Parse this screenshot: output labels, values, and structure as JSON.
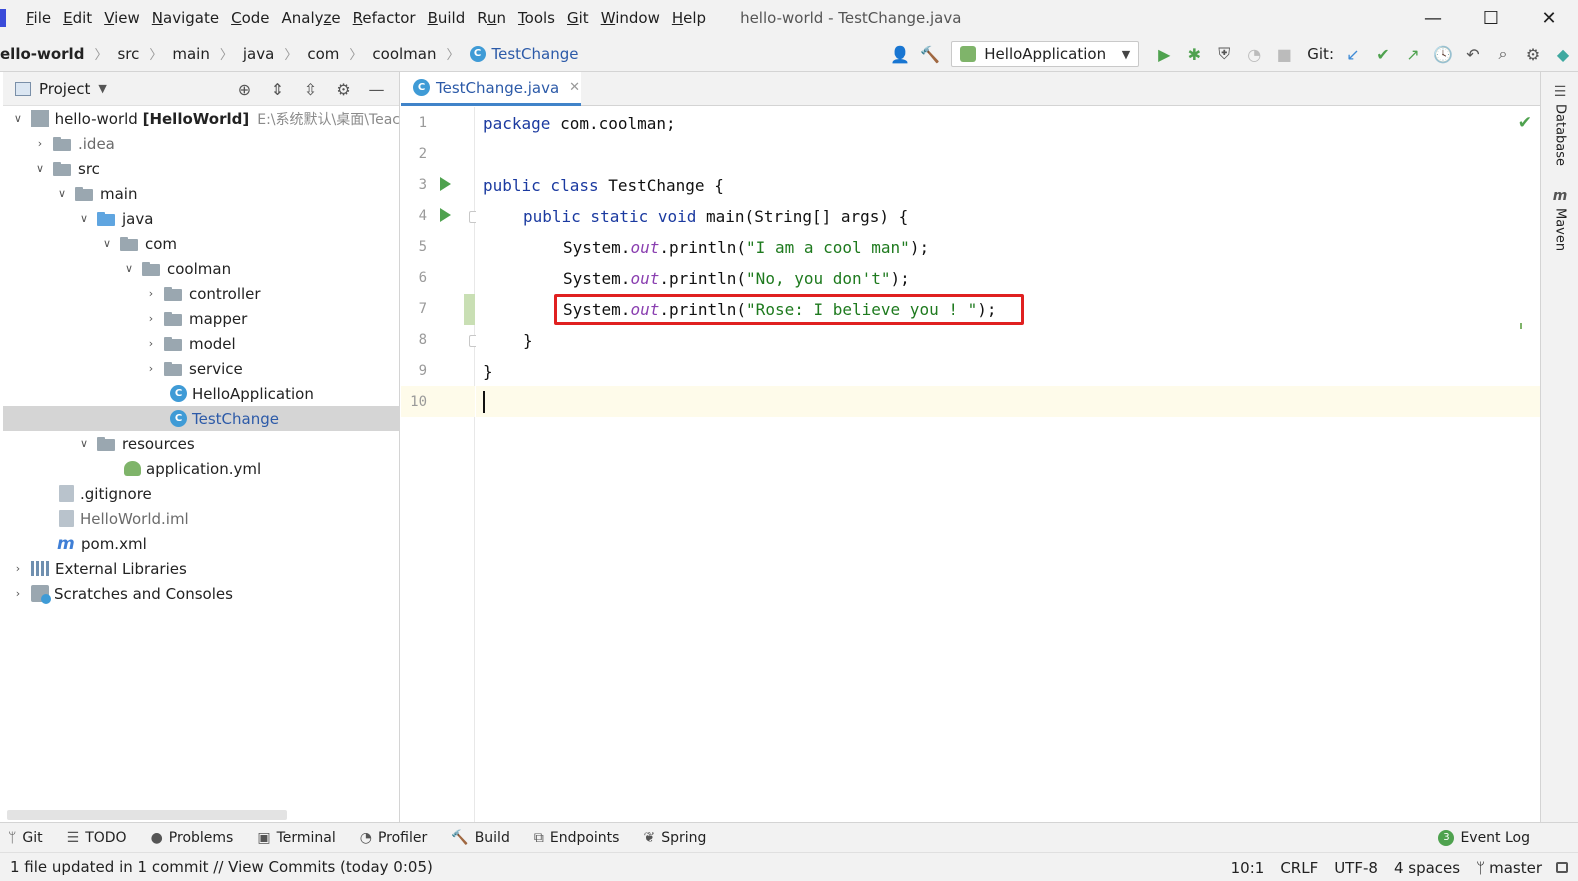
{
  "menu": {
    "items": [
      {
        "pre": "",
        "mn": "F",
        "post": "ile"
      },
      {
        "pre": "",
        "mn": "E",
        "post": "dit"
      },
      {
        "pre": "",
        "mn": "V",
        "post": "iew"
      },
      {
        "pre": "",
        "mn": "N",
        "post": "avigate"
      },
      {
        "pre": "",
        "mn": "C",
        "post": "ode"
      },
      {
        "pre": "Analy",
        "mn": "z",
        "post": "e"
      },
      {
        "pre": "",
        "mn": "R",
        "post": "efactor"
      },
      {
        "pre": "",
        "mn": "B",
        "post": "uild"
      },
      {
        "pre": "R",
        "mn": "u",
        "post": "n"
      },
      {
        "pre": "",
        "mn": "T",
        "post": "ools"
      },
      {
        "pre": "",
        "mn": "G",
        "post": "it"
      },
      {
        "pre": "",
        "mn": "W",
        "post": "indow"
      },
      {
        "pre": "",
        "mn": "H",
        "post": "elp"
      }
    ],
    "window_title": "hello-world - TestChange.java",
    "minimize": "—",
    "maximize": "☐",
    "close": "✕"
  },
  "breadcrumb": [
    "ello-world",
    "src",
    "main",
    "java",
    "com",
    "coolman",
    "TestChange"
  ],
  "toolbar": {
    "run_config": "HelloApplication",
    "git_label": "Git:"
  },
  "project": {
    "header": "Project",
    "tree": [
      {
        "label": "hello-world",
        "bold": "[HelloWorld]",
        "hint": "E:\\系统默认\\桌面\\Teac"
      },
      {
        "label": ".idea"
      },
      {
        "label": "src"
      },
      {
        "label": "main"
      },
      {
        "label": "java"
      },
      {
        "label": "com"
      },
      {
        "label": "coolman"
      },
      {
        "label": "controller"
      },
      {
        "label": "mapper"
      },
      {
        "label": "model"
      },
      {
        "label": "service"
      },
      {
        "label": "HelloApplication"
      },
      {
        "label": "TestChange"
      },
      {
        "label": "resources"
      },
      {
        "label": "application.yml"
      },
      {
        "label": ".gitignore"
      },
      {
        "label": "HelloWorld.iml"
      },
      {
        "label": "pom.xml"
      },
      {
        "label": "External Libraries"
      },
      {
        "label": "Scratches and Consoles"
      }
    ]
  },
  "editor": {
    "tab_label": "TestChange.java",
    "line_numbers": [
      "1",
      "2",
      "3",
      "4",
      "5",
      "6",
      "7",
      "8",
      "9",
      "10"
    ],
    "code": {
      "l1_kw": "package",
      "l1_rest": " com.coolman;",
      "l3_kw": "public class",
      "l3_rest": " TestChange {",
      "l4_kw": "public static void",
      "l4_rest": " main(String[] args) {",
      "sys": "System.",
      "out": "out",
      "println": ".println(",
      "l5_str": "\"I am a cool man\"",
      "l6_str": "\"No, you don't\"",
      "l7_str": "\"Rose: I believe you ! \"",
      "end": ");",
      "l8": "}",
      "l9": "}"
    }
  },
  "right_tools": [
    "Database",
    "Maven"
  ],
  "tool_tabs": [
    {
      "icon": "git-icon",
      "label": "Git"
    },
    {
      "icon": "todo-icon",
      "label": "TODO"
    },
    {
      "icon": "problems-icon",
      "label": "Problems"
    },
    {
      "icon": "terminal-icon",
      "label": "Terminal"
    },
    {
      "icon": "profiler-icon",
      "label": "Profiler"
    },
    {
      "icon": "build-icon",
      "label": "Build"
    },
    {
      "icon": "endpoints-icon",
      "label": "Endpoints"
    },
    {
      "icon": "spring-icon",
      "label": "Spring"
    }
  ],
  "event_log": {
    "badge": "3",
    "label": "Event Log"
  },
  "status": {
    "message": "1 file updated in 1 commit // View Commits (today 0:05)",
    "position": "10:1",
    "line_sep": "CRLF",
    "encoding": "UTF-8",
    "indent": "4 spaces",
    "branch": "master"
  }
}
